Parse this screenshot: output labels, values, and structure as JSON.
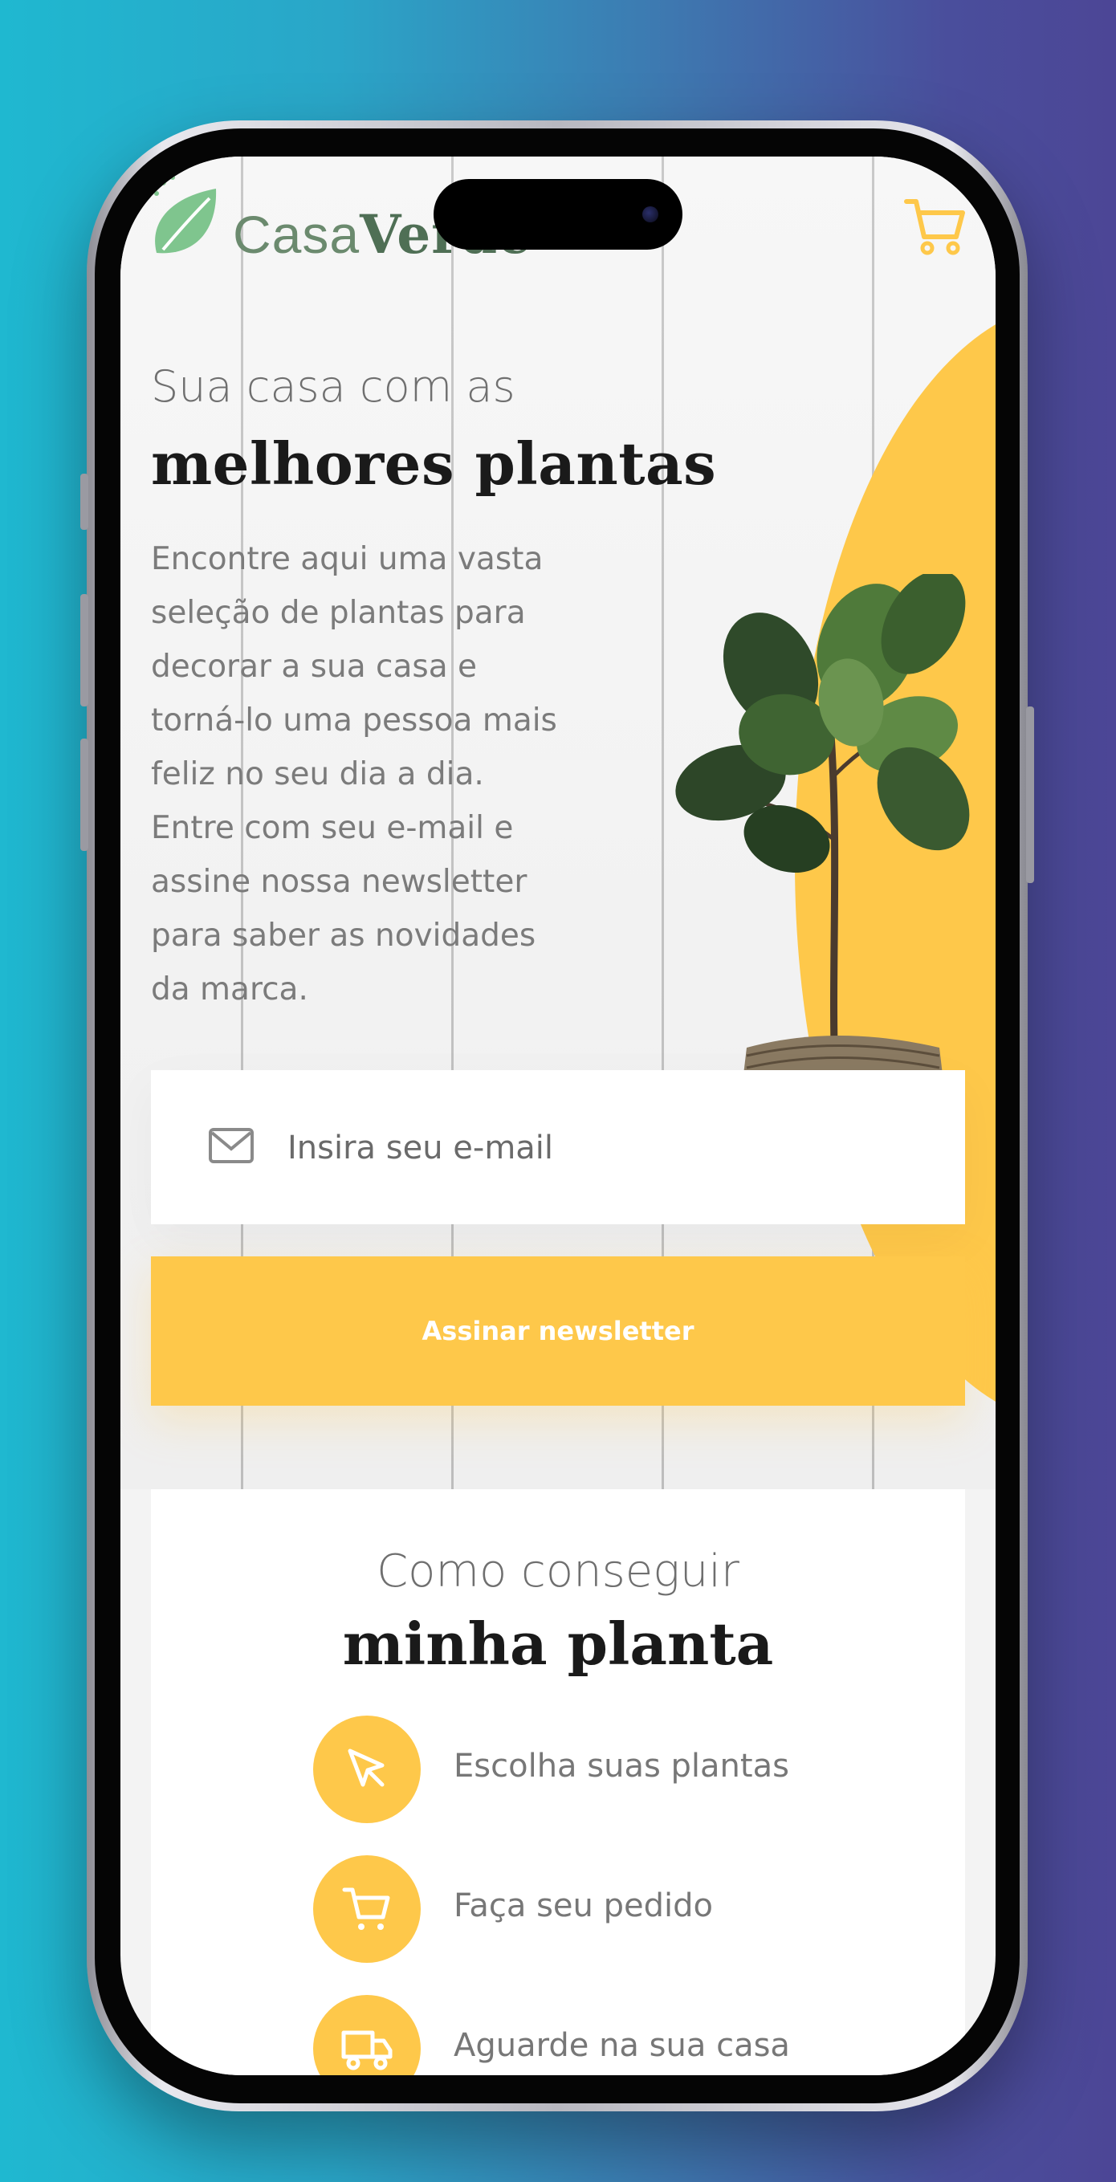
{
  "brand": {
    "logo_part1": "Casa",
    "logo_part2": "Verde",
    "primary_color": "#fec84a",
    "logo_color": "#6b8a6e"
  },
  "header": {
    "cart_icon": "cart-icon"
  },
  "hero": {
    "subtitle": "Sua casa com as",
    "title": "melhores plantas",
    "description": "Encontre aqui uma vasta seleção de plantas para decorar a sua casa e torná-lo uma pessoa mais feliz no seu dia a dia. Entre com seu e-mail e assine nossa newsletter para saber as novidades da marca."
  },
  "newsletter": {
    "email_placeholder": "Insira seu e-mail",
    "email_value": "",
    "submit_label": "Assinar newsletter"
  },
  "how": {
    "subtitle": "Como conseguir",
    "title": "minha planta",
    "steps": [
      {
        "icon": "pointer-icon",
        "label": "Escolha suas plantas"
      },
      {
        "icon": "cart-icon",
        "label": "Faça seu pedido"
      },
      {
        "icon": "truck-icon",
        "label": "Aguarde na sua casa"
      }
    ]
  }
}
